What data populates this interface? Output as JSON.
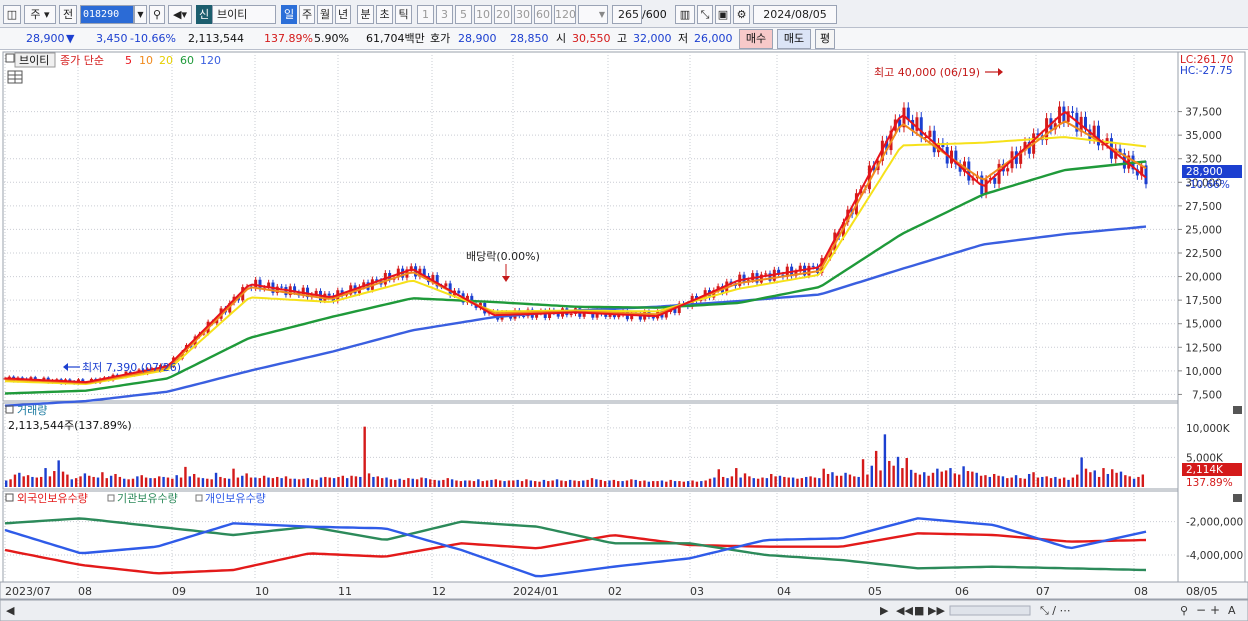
{
  "toolbar": {
    "period_type": "주",
    "prev_label": "전",
    "stock_code": "018290",
    "credit_tag": "신",
    "stock_name": "브이티",
    "timeframes": [
      "일",
      "주",
      "월",
      "년",
      "분",
      "초",
      "틱"
    ],
    "active_timeframe": "일",
    "intervals": [
      "1",
      "3",
      "5",
      "10",
      "20",
      "30",
      "60",
      "120"
    ],
    "count_value": "265",
    "count_total": "/600",
    "date_value": "2024/08/05"
  },
  "quote": {
    "price": "28,900",
    "direction_symbol": "▼",
    "change": "3,450",
    "change_rate": "-10.66%",
    "volume": "2,113,544",
    "volume_ratio": "137.89%",
    "turnover": "5.90%",
    "trade_value": "61,704백만",
    "ask_label": "호가",
    "ask1": "28,900",
    "ask2": "28,850",
    "open_label": "시",
    "open": "30,550",
    "high_label": "고",
    "high": "32,000",
    "low_label": "저",
    "low": "26,000",
    "buy_button": "매수",
    "sell_button": "매도",
    "eval_button": "평"
  },
  "price_panel": {
    "title": "브이티",
    "indicator_label": "종가 단순",
    "ma_periods": [
      "5",
      "10",
      "20",
      "60",
      "120"
    ],
    "lc_label": "LC:261.70",
    "hc_label": "HC:-27.75",
    "current_price_tag": "28,900",
    "current_change_tag": "-10.66%",
    "high_annotation": "최고 40,000 (06/19)",
    "low_annotation": "최저 7,390 (07/26)",
    "dividend_annotation": "배당락(0.00%)"
  },
  "volume_panel": {
    "title": "거래량",
    "value_label": "2,113,544주(137.89%)",
    "tick_labels": [
      "10,000K",
      "5,000K"
    ],
    "current_tag": "2,114K",
    "current_ratio": "137.89%"
  },
  "holding_panel": {
    "series_labels": [
      "외국인보유수량",
      "기관보유수량",
      "개인보유수량"
    ],
    "tick_labels": [
      "-2,000,000",
      "-4,000,000"
    ]
  },
  "x_axis": {
    "labels": [
      "2023/07",
      "08",
      "09",
      "10",
      "11",
      "12",
      "2024/01",
      "02",
      "03",
      "04",
      "05",
      "06",
      "07",
      "08",
      "08/05"
    ]
  },
  "colors": {
    "up": "#d41a1a",
    "down": "#1c3fd0",
    "ma5": "#e8131b",
    "ma10": "#f08a1c",
    "ma20": "#f6e11a",
    "ma60": "#1f9a3a",
    "ma120": "#3a5fe0",
    "foreign": "#e31a1a",
    "institution": "#2c8a5a",
    "individual": "#2f5be8"
  },
  "chart_data": [
    {
      "type": "line",
      "title": "브이티",
      "subtitle": "종가 단순 5 10 20 60 120",
      "x": [
        "2023/07",
        "08",
        "09",
        "10",
        "11",
        "12",
        "2024/01",
        "02",
        "03",
        "04",
        "05",
        "06",
        "07",
        "08"
      ],
      "ylim": [
        5000,
        40000
      ],
      "y_ticks": [
        "7,500",
        "10,000",
        "12,500",
        "15,000",
        "17,500",
        "20,000",
        "22,500",
        "25,000",
        "27,500",
        "30,000",
        "32,500",
        "35,000",
        "37,500"
      ],
      "series": [
        {
          "name": "5",
          "values": [
            9200,
            8800,
            10500,
            19200,
            17800,
            20800,
            15900,
            16200,
            15800,
            19600,
            21000,
            37300,
            29500,
            37500,
            30500
          ]
        },
        {
          "name": "10",
          "values": [
            9100,
            8700,
            10300,
            18900,
            17600,
            20500,
            16100,
            16300,
            16000,
            19300,
            20600,
            36300,
            30200,
            36500,
            31500
          ]
        },
        {
          "name": "20",
          "values": [
            8900,
            8600,
            10100,
            17800,
            17300,
            19600,
            16300,
            16400,
            16300,
            18700,
            20200,
            33900,
            34200,
            34800,
            33800
          ]
        },
        {
          "name": "60",
          "values": [
            7600,
            7900,
            9200,
            13500,
            15700,
            17700,
            17300,
            16800,
            16700,
            17200,
            18900,
            24500,
            28700,
            31300,
            32200
          ]
        },
        {
          "name": "120",
          "values": [
            6300,
            6800,
            7800,
            10000,
            12000,
            14300,
            15700,
            16400,
            16800,
            17400,
            18100,
            20800,
            23400,
            24500,
            25300
          ]
        }
      ]
    },
    {
      "type": "bar",
      "title": "거래량",
      "x": [
        "2023/07",
        "08",
        "09",
        "10",
        "11",
        "12",
        "2024/01",
        "02",
        "03",
        "04",
        "05",
        "06",
        "07",
        "08"
      ],
      "ylim": [
        0,
        12000
      ],
      "units": "K",
      "values": [
        1100,
        1300,
        2100,
        2400,
        1800,
        2000,
        1700,
        1600,
        1700,
        3200,
        1800,
        2700,
        4500,
        2600,
        2100,
        1300,
        1500,
        1800,
        2300,
        1900,
        1700,
        1600,
        2500,
        1500,
        1900,
        2200,
        1700,
        1400,
        1300,
        1400,
        1800,
        2000,
        1600,
        1500,
        1500,
        1800,
        1700,
        1600,
        1400,
        2000,
        1600,
        3400,
        1800,
        2200,
        1600,
        1500,
        1400,
        1300,
        2400,
        1700,
        1500,
        1400,
        3100,
        1600,
        1900,
        2300,
        1600,
        1600,
        1500,
        1900,
        1600,
        1500,
        1700,
        1500,
        1800,
        1400,
        1400,
        1300,
        1400,
        1500,
        1300,
        1200,
        1600,
        1700,
        1600,
        1500,
        1700,
        1900,
        1500,
        1900,
        1800,
        1700,
        10200,
        2300,
        1700,
        1800,
        1500,
        1600,
        1300,
        1200,
        1400,
        1200,
        1500,
        1400,
        1300,
        1600,
        1500,
        1300,
        1200,
        1100,
        1200,
        1500,
        1300,
        1100,
        1000,
        1100,
        1100,
        1000,
        1300,
        1000,
        1100,
        1200,
        1300,
        1100,
        1000,
        1100,
        1100,
        1200,
        1000,
        1300,
        1100,
        1000,
        900,
        1200,
        1000,
        1100,
        1300,
        1100,
        1000,
        1200,
        1100,
        1000,
        1100,
        1200,
        1500,
        1300,
        1200,
        1000,
        1100,
        1200,
        1000,
        1000,
        1100,
        1300,
        1200,
        1000,
        1100,
        900,
        1000,
        1000,
        1100,
        900,
        1200,
        1000,
        1000,
        900,
        1000,
        1100,
        900,
        1000,
        1100,
        1400,
        1600,
        3000,
        1700,
        1500,
        1800,
        3200,
        1600,
        2300,
        1800,
        1500,
        1400,
        1600,
        1500,
        2200,
        1800,
        1900,
        1700,
        1600,
        1600,
        1400,
        1500,
        1700,
        1800,
        1600,
        1500,
        3100,
        2200,
        2500,
        1900,
        1900,
        2400,
        2100,
        1800,
        1700,
        4700,
        2100,
        3600,
        6100,
        2800,
        8900,
        4400,
        3600,
        5100,
        3200,
        4900,
        2900,
        2400,
        2100,
        2500,
        1900,
        2400,
        3100,
        2600,
        2800,
        3200,
        2300,
        2100,
        3500,
        2700,
        2600,
        2400,
        1900,
        2000,
        1700,
        2200,
        1900,
        1800,
        1500,
        1600,
        2000,
        1500,
        1400,
        2200,
        2500,
        1600,
        1700,
        1800,
        1500,
        1700,
        1400,
        1600,
        1200,
        1600,
        2100,
        5000,
        3100,
        2500,
        2800,
        1700,
        3200,
        2200,
        3000,
        2400,
        2600,
        2000,
        1800,
        1400,
        1700,
        2114
      ]
    },
    {
      "type": "line",
      "title": "외국인보유수량 기관보유수량 개인보유수량",
      "x": [
        "2023/07",
        "08",
        "09",
        "10",
        "11",
        "12",
        "2024/01",
        "02",
        "03",
        "04",
        "05",
        "06",
        "07",
        "08"
      ],
      "ylim": [
        -5500000,
        -1000000
      ],
      "series": [
        {
          "name": "외국인보유수량",
          "values": [
            -3700000,
            -4600000,
            -5100000,
            -4900000,
            -3900000,
            -4100000,
            -3300000,
            -3600000,
            -2800000,
            -3400000,
            -3500000,
            -3500000,
            -2700000,
            -2800000,
            -3200000,
            -3100000
          ]
        },
        {
          "name": "기관보유수량",
          "values": [
            -2100000,
            -1800000,
            -2300000,
            -2800000,
            -2300000,
            -3100000,
            -2000000,
            -2300000,
            -3300000,
            -3300000,
            -4000000,
            -4300000,
            -4800000,
            -4700000,
            -4800000,
            -4900000
          ]
        },
        {
          "name": "개인보유수량",
          "values": [
            -2500000,
            -3900000,
            -3500000,
            -2100000,
            -2300000,
            -2400000,
            -3700000,
            -5300000,
            -4700000,
            -4200000,
            -3100000,
            -3000000,
            -1800000,
            -2200000,
            -3600000,
            -2600000
          ]
        }
      ]
    }
  ]
}
